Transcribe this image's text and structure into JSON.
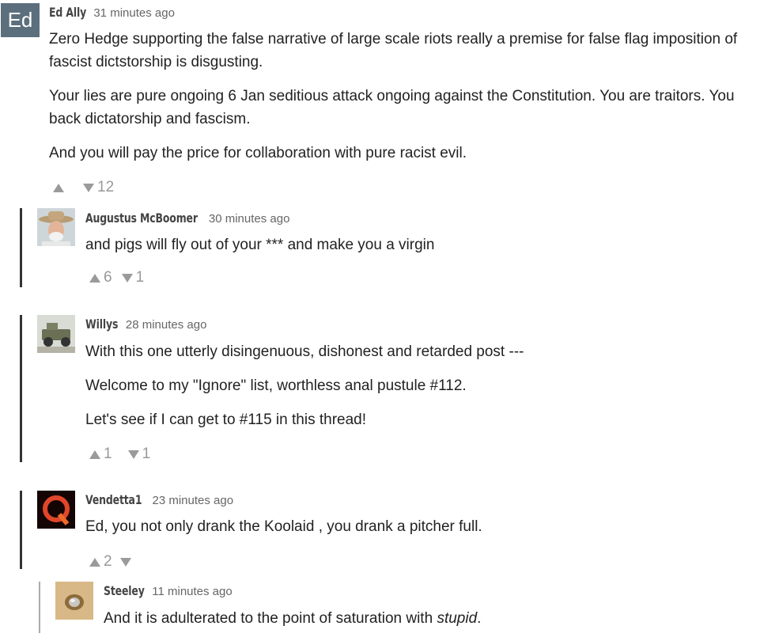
{
  "comments": [
    {
      "author": "Ed Ally",
      "time": "31 minutes ago",
      "avatar_text": "Ed",
      "paragraphs": [
        "Zero Hedge supporting the false narrative of large scale riots really a premise for false flag imposition of fascist dictstorship is disgusting.",
        "Your lies are pure ongoing 6 Jan seditious attack ongoing against the Constitution. You are traitors. You back dictatorship and fascism.",
        "And you will pay the price for collaboration with pure racist evil."
      ],
      "up": "",
      "down": "12"
    },
    {
      "author": "Augustus McBoomer",
      "time": "30 minutes ago",
      "paragraphs": [
        "and pigs will fly out of your *** and make you a virgin"
      ],
      "up": "6",
      "down": "1"
    },
    {
      "author": "Willys",
      "time": "28 minutes ago",
      "paragraphs": [
        "With this one utterly disingenuous, dishonest and retarded post ---",
        "Welcome to my \"Ignore\" list, worthless anal pustule #112.",
        "Let's see if I can get to #115 in this thread!"
      ],
      "up": "1",
      "down": "1"
    },
    {
      "author": "Vendetta1",
      "time": "23 minutes ago",
      "paragraphs": [
        "Ed, you not only drank the Koolaid , you drank a pitcher full."
      ],
      "up": "2",
      "down": ""
    },
    {
      "author": "Steeley",
      "time": "11 minutes ago",
      "paragraph_before": "And it is adulterated to the point of saturation with ",
      "paragraph_em": "stupid",
      "paragraph_after": ".",
      "up": "",
      "down": ""
    }
  ],
  "colors": {
    "text": "#222222",
    "author": "#444444",
    "time": "#666666",
    "vote": "#9a9a9a",
    "thread_line": "#333333",
    "ed_avatar_bg": "#5c6f7d"
  }
}
